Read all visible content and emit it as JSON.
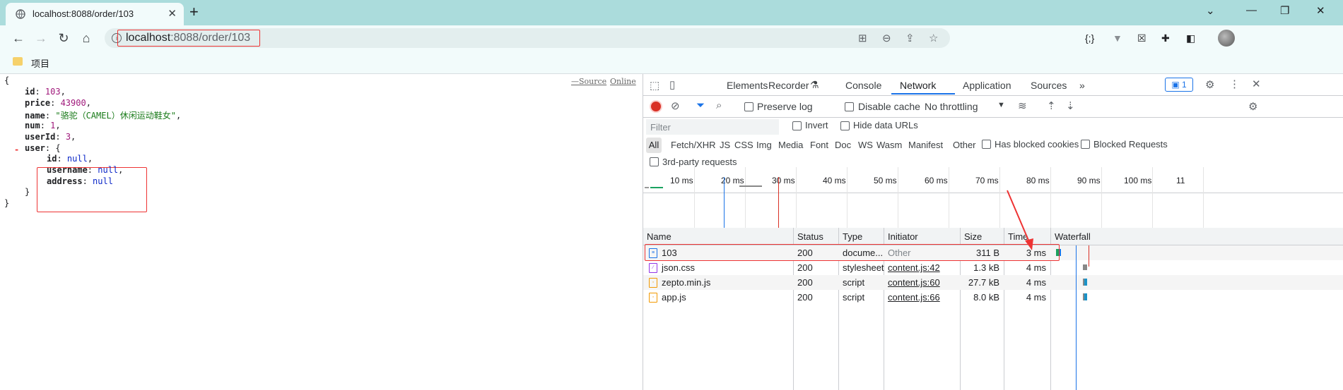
{
  "tab": {
    "title": "localhost:8088/order/103"
  },
  "address": {
    "host": "localhost",
    "rest": ":8088/order/103"
  },
  "bookmarks": [
    {
      "label": "项目"
    }
  ],
  "json_viewer": {
    "source_label": "—Source",
    "online_label": "Online",
    "brace_open": "{",
    "brace_close": "}",
    "fields": [
      {
        "key": "id",
        "value": "103",
        "kind": "num"
      },
      {
        "key": "price",
        "value": "43900",
        "kind": "num"
      },
      {
        "key": "name",
        "value": "\"骆驼（CAMEL）休闲运动鞋女\"",
        "kind": "str"
      },
      {
        "key": "num",
        "value": "1",
        "kind": "num"
      },
      {
        "key": "userId",
        "value": "3",
        "kind": "num"
      }
    ],
    "user_key": "user",
    "user_fields": [
      {
        "key": "id",
        "value": "null"
      },
      {
        "key": "username",
        "value": "null"
      },
      {
        "key": "address",
        "value": "null"
      }
    ]
  },
  "devtools": {
    "tabs": [
      "Elements",
      "Recorder",
      "Console",
      "Network",
      "Application",
      "Sources"
    ],
    "active_tab": "Network",
    "issues_count": "1",
    "preserve_log": "Preserve log",
    "disable_cache": "Disable cache",
    "throttling": "No throttling",
    "filter_placeholder": "Filter",
    "invert": "Invert",
    "hide_data_urls": "Hide data URLs",
    "types": [
      "All",
      "Fetch/XHR",
      "JS",
      "CSS",
      "Img",
      "Media",
      "Font",
      "Doc",
      "WS",
      "Wasm",
      "Manifest",
      "Other"
    ],
    "has_blocked_cookies": "Has blocked cookies",
    "blocked_requests": "Blocked Requests",
    "third_party": "3rd-party requests",
    "timeline_ticks": [
      "10 ms",
      "20 ms",
      "30 ms",
      "40 ms",
      "50 ms",
      "60 ms",
      "70 ms",
      "80 ms",
      "90 ms",
      "100 ms",
      "11"
    ],
    "columns": [
      "Name",
      "Status",
      "Type",
      "Initiator",
      "Size",
      "Time",
      "Waterfall"
    ],
    "rows": [
      {
        "name": "103",
        "icon": "document-icon",
        "status": "200",
        "type": "docume...",
        "initiator": "Other",
        "size": "311 B",
        "time": "3 ms"
      },
      {
        "name": "json.css",
        "icon": "stylesheet-icon",
        "status": "200",
        "type": "stylesheet",
        "initiator": "content.js:42",
        "size": "1.3 kB",
        "time": "4 ms"
      },
      {
        "name": "zepto.min.js",
        "icon": "script-icon",
        "status": "200",
        "type": "script",
        "initiator": "content.js:60",
        "size": "27.7 kB",
        "time": "4 ms"
      },
      {
        "name": "app.js",
        "icon": "script-icon",
        "status": "200",
        "type": "script",
        "initiator": "content.js:66",
        "size": "8.0 kB",
        "time": "4 ms"
      }
    ]
  },
  "colors": {
    "highlight": "#e33",
    "accent": "#1a73e8"
  }
}
